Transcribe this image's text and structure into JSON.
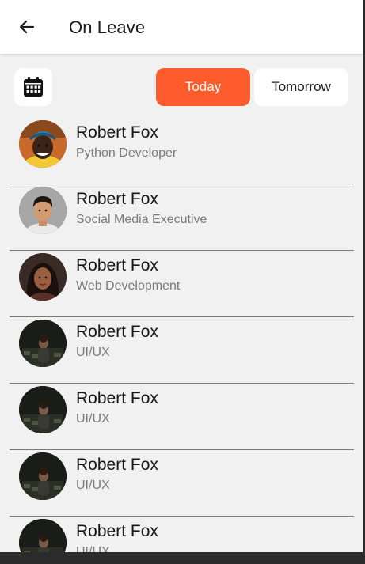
{
  "header": {
    "title": "On Leave",
    "back_icon": "arrow-left-icon"
  },
  "filters": {
    "calendar_icon": "calendar-icon",
    "today_label": "Today",
    "tomorrow_label": "Tomorrow",
    "active": "Today",
    "accent_color": "#ff5c2e"
  },
  "employees": [
    {
      "name": "Robert Fox",
      "role": "Python Developer",
      "avatar": "man-blue-headwrap"
    },
    {
      "name": "Robert Fox",
      "role": "Social Media Executive",
      "avatar": "young-man-grey"
    },
    {
      "name": "Robert Fox",
      "role": "Web Development",
      "avatar": "woman-dark-hair"
    },
    {
      "name": "Robert Fox",
      "role": "UI/UX",
      "avatar": "man-dark-room"
    },
    {
      "name": "Robert Fox",
      "role": "UI/UX",
      "avatar": "man-dark-room"
    },
    {
      "name": "Robert Fox",
      "role": "UI/UX",
      "avatar": "man-dark-room"
    },
    {
      "name": "Robert Fox",
      "role": "UI/UX",
      "avatar": "man-dark-room"
    }
  ]
}
